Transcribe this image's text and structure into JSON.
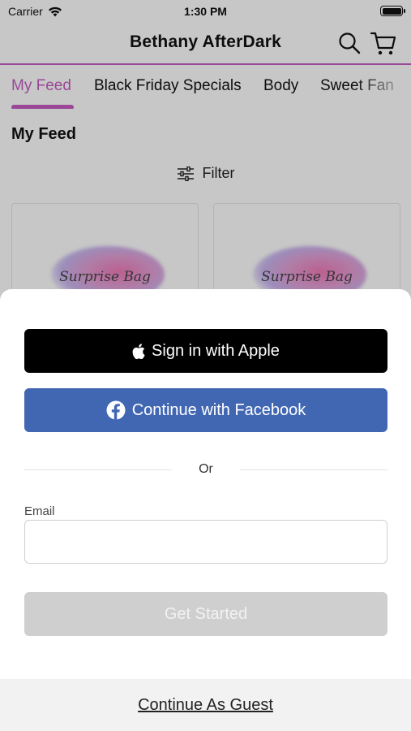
{
  "status_bar": {
    "carrier": "Carrier",
    "time": "1:30 PM"
  },
  "header": {
    "title": "Bethany AfterDark",
    "icons": [
      "search-icon",
      "cart-icon"
    ]
  },
  "tabs": [
    {
      "label": "My Feed",
      "active": true
    },
    {
      "label": "Black Friday Specials",
      "active": false
    },
    {
      "label": "Body",
      "active": false
    },
    {
      "label": "Sweet Fan",
      "active": false
    }
  ],
  "feed": {
    "title": "My Feed",
    "filter_label": "Filter",
    "cards": [
      {
        "text": "Surprise Bag"
      },
      {
        "text": "Surprise Bag"
      }
    ]
  },
  "sheet": {
    "apple_button": "Sign in with Apple",
    "facebook_button": "Continue with Facebook",
    "divider_text": "Or",
    "email_label": "Email",
    "email_value": "",
    "submit_button": "Get Started",
    "guest_link": "Continue As Guest"
  },
  "colors": {
    "accent": "#c45bc0",
    "facebook": "#4267b2",
    "apple": "#000000",
    "disabled": "#cfcfcf"
  }
}
